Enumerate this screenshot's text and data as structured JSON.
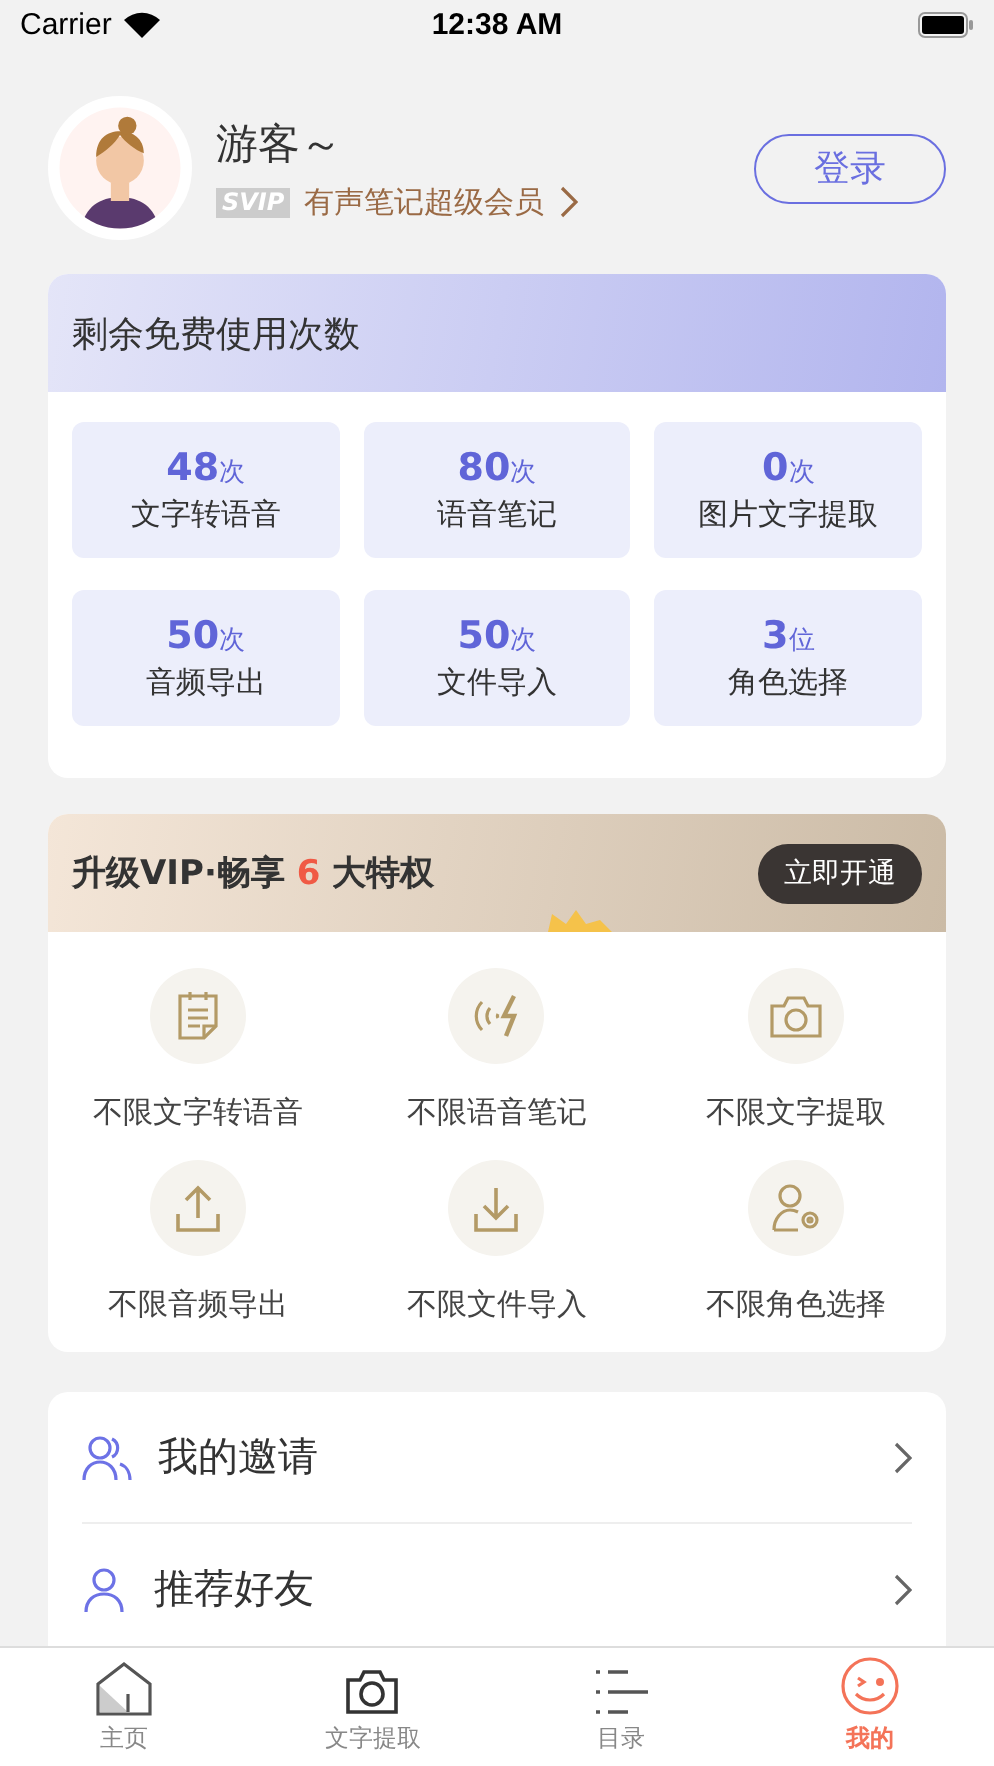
{
  "status_bar": {
    "carrier": "Carrier",
    "time": "12:38 AM"
  },
  "profile": {
    "name": "游客～",
    "badge": "SVIP",
    "membership": "有声笔记超级会员",
    "login_button": "登录"
  },
  "quota": {
    "title": "剩余免费使用次数",
    "items": [
      {
        "count": "48",
        "unit": "次",
        "label": "文字转语音"
      },
      {
        "count": "80",
        "unit": "次",
        "label": "语音笔记"
      },
      {
        "count": "0",
        "unit": "次",
        "label": "图片文字提取"
      },
      {
        "count": "50",
        "unit": "次",
        "label": "音频导出"
      },
      {
        "count": "50",
        "unit": "次",
        "label": "文件导入"
      },
      {
        "count": "3",
        "unit": "位",
        "label": "角色选择"
      }
    ]
  },
  "vip": {
    "title": "升级VIP·畅享",
    "count": "6",
    "title_suffix": "大特权",
    "button": "立即开通",
    "benefits": [
      {
        "kind": "note",
        "label": "不限文字转语音"
      },
      {
        "kind": "voice",
        "label": "不限语音笔记"
      },
      {
        "kind": "camera",
        "label": "不限文字提取"
      },
      {
        "kind": "upload",
        "label": "不限音频导出"
      },
      {
        "kind": "download",
        "label": "不限文件导入"
      },
      {
        "kind": "role",
        "label": "不限角色选择"
      }
    ]
  },
  "menu": [
    {
      "kind": "people",
      "label": "我的邀请"
    },
    {
      "kind": "person",
      "label": "推荐好友"
    }
  ],
  "tabs": [
    {
      "kind": "home",
      "label": "主页",
      "selected": false
    },
    {
      "kind": "camera",
      "label": "文字提取",
      "selected": false
    },
    {
      "kind": "list",
      "label": "目录",
      "selected": false
    },
    {
      "kind": "face",
      "label": "我的",
      "selected": true
    }
  ]
}
